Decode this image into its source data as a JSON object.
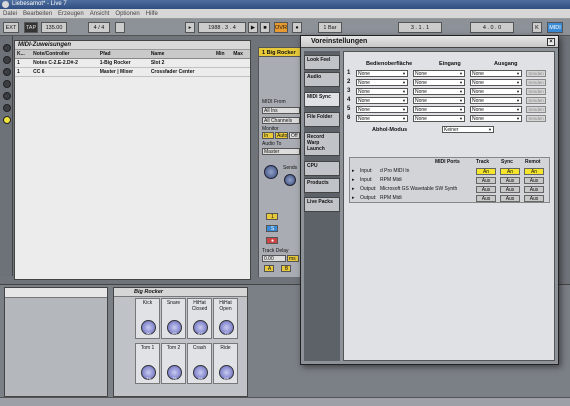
{
  "window": {
    "title": "Liebesamot* - Live 7"
  },
  "menu": [
    "Datei",
    "Bearbeiten",
    "Erzeugen",
    "Ansicht",
    "Optionen",
    "Hilfe"
  ],
  "transport": {
    "ext": "EXT",
    "tap": "TAP",
    "tempo": "135.00",
    "time_sig": "4 / 4",
    "ovr": "OVR",
    "pos": "1988 . 3 . 4",
    "loop": "1 Bar",
    "pos2": "3 . 1 . 1",
    "end": "4 . 0 . 0"
  },
  "midi_mapping": {
    "title": "MIDI-Zuweisungen",
    "columns": [
      "K...",
      "Note/Controller",
      "Pfad",
      "Name",
      "Min",
      "Max"
    ],
    "rows": [
      [
        "1",
        "Notes C-2.E-2.D#-2",
        "1-Big Rocker",
        "Slot 2",
        "",
        ""
      ],
      [
        "1",
        "CC 6",
        "Master | Mixer",
        "Crossfader Center",
        "",
        ""
      ]
    ]
  },
  "track": {
    "name": "1 Big Rocker",
    "midi_from": "MIDI From",
    "midi_from_val": "All Ins",
    "channel": "All Channels",
    "monitor": "Monitor",
    "monitor_opts": [
      "In",
      "Auto",
      "Off"
    ],
    "audio_to": "Audio To",
    "audio_to_val": "Master",
    "sends": "Sends",
    "track_delay": "Track Delay",
    "delay_val": "0.00",
    "delay_unit": "ms",
    "num": "1",
    "solo": "S",
    "arm": "A",
    "b": "B"
  },
  "rack": {
    "title": "Big Rocker",
    "pads": [
      {
        "name": "Kick",
        "val": "90"
      },
      {
        "name": "Snare",
        "val": "83"
      },
      {
        "name": "HiHat Closed",
        "val": "67"
      },
      {
        "name": "HiHat Open",
        "val": "72"
      },
      {
        "name": "Tom 1",
        "val": "79"
      },
      {
        "name": "Tom 2",
        "val": "76"
      },
      {
        "name": "Crash",
        "val": "68"
      },
      {
        "name": "Ride",
        "val": "64"
      }
    ]
  },
  "dialog": {
    "title": "Voreinstellungen",
    "close": "×",
    "tabs": [
      "Look Feel",
      "Audio",
      "MIDI Sync",
      "File Folder",
      "Record Warp Launch",
      "CPU",
      "Products",
      "Live Packs"
    ],
    "headers": {
      "surface": "Bedienoberfläche",
      "input": "Eingang",
      "output": "Ausgang"
    },
    "rows": [
      "1",
      "2",
      "3",
      "4",
      "5",
      "6"
    ],
    "none": "None",
    "dump": "Senden",
    "takeover_label": "Abhol-Modus",
    "takeover_value": "Keiner",
    "ports_header": "MIDI Ports",
    "ports_cols": [
      "Track",
      "Sync",
      "Remot"
    ],
    "ports": [
      {
        "dir": "Input:",
        "name": "d Pro MIDI In",
        "track": "An",
        "sync": "An",
        "remote": "An",
        "on": true
      },
      {
        "dir": "Input:",
        "name": "RPM Midi",
        "track": "Aus",
        "sync": "Aus",
        "remote": "Aus",
        "on": false
      },
      {
        "dir": "Output:",
        "name": "Microsoft GS Wavetable SW Synth",
        "track": "Aus",
        "sync": "Aus",
        "remote": "Aus",
        "on": false
      },
      {
        "dir": "Output:",
        "name": "RPM Midi",
        "track": "Aus",
        "sync": "Aus",
        "remote": "Aus",
        "on": false
      }
    ]
  }
}
